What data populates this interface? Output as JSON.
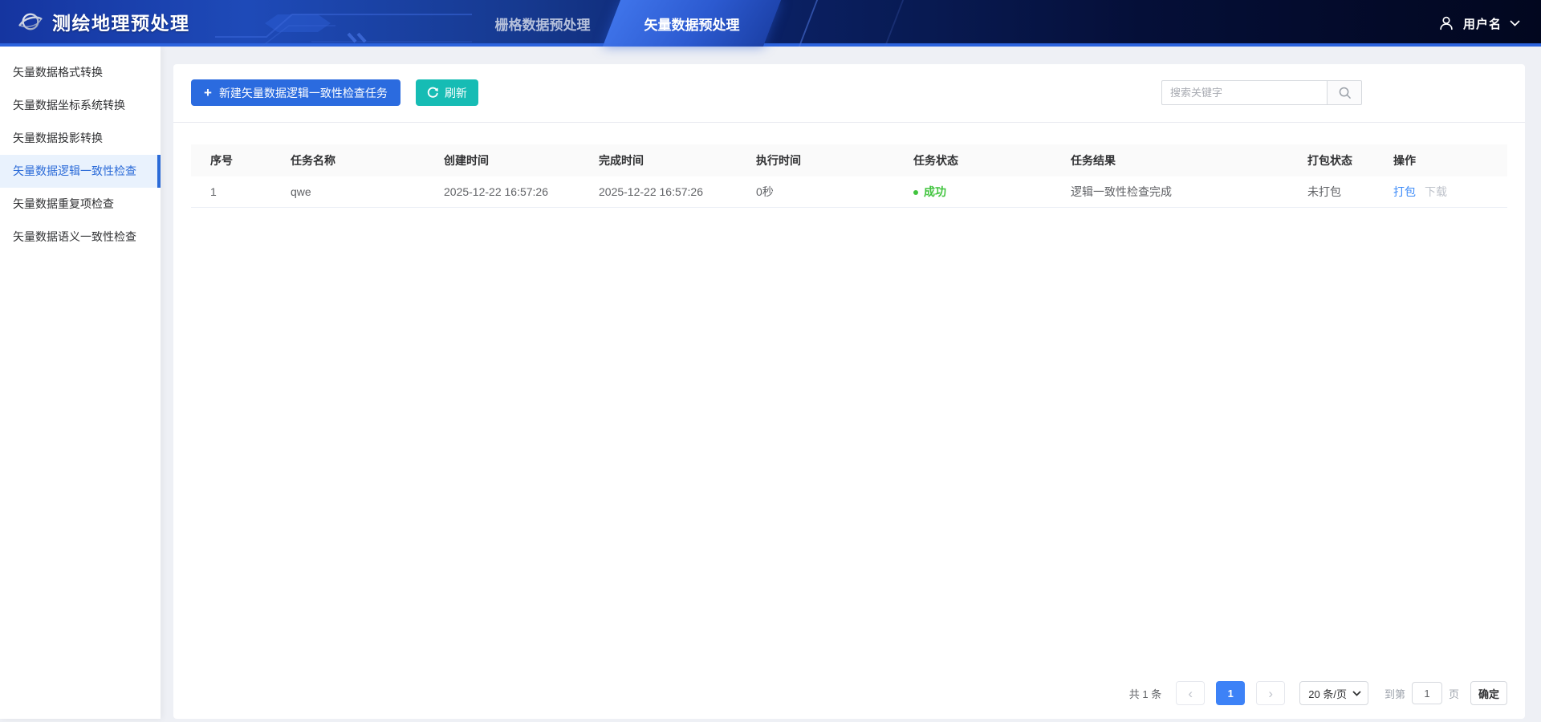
{
  "app": {
    "title": "测绘地理预处理"
  },
  "header": {
    "tabs": [
      {
        "label": "栅格数据预处理",
        "active": false
      },
      {
        "label": "矢量数据预处理",
        "active": true
      }
    ],
    "user_name": "用户名"
  },
  "sidebar": {
    "items": [
      {
        "label": "矢量数据格式转换",
        "active": false
      },
      {
        "label": "矢量数据坐标系统转换",
        "active": false
      },
      {
        "label": "矢量数据投影转换",
        "active": false
      },
      {
        "label": "矢量数据逻辑一致性检查",
        "active": true
      },
      {
        "label": "矢量数据重复项检查",
        "active": false
      },
      {
        "label": "矢量数据语义一致性检查",
        "active": false
      }
    ]
  },
  "toolbar": {
    "new_task_label": "新建矢量数据逻辑一致性检查任务",
    "refresh_label": "刷新",
    "search_placeholder": "搜索关键字"
  },
  "table": {
    "headers": [
      "序号",
      "任务名称",
      "创建时间",
      "完成时间",
      "执行时间",
      "任务状态",
      "任务结果",
      "打包状态",
      "操作"
    ],
    "rows": [
      {
        "index": "1",
        "name": "qwe",
        "created_at": "2025-12-22 16:57:26",
        "finished_at": "2025-12-22 16:57:26",
        "duration": "0秒",
        "status": "成功",
        "result": "逻辑一致性检查完成",
        "package_state": "未打包",
        "action_package": "打包",
        "action_download": "下载"
      }
    ]
  },
  "pagination": {
    "total": "共 1 条",
    "page": "1",
    "page_size": "20 条/页",
    "goto_prefix": "到第",
    "goto_value": "1",
    "goto_suffix": "页",
    "confirm": "确定"
  },
  "icons": {
    "plus": "+",
    "prev": "‹",
    "next": "›"
  },
  "colors": {
    "primary": "#2b6bdf",
    "refresh": "#16bcb4",
    "link": "#3d8bf8",
    "success": "#41c43e",
    "active_page": "#3d82f7",
    "header_accent": "#2c63dd",
    "sidebar_active": "#2b6bd8"
  }
}
